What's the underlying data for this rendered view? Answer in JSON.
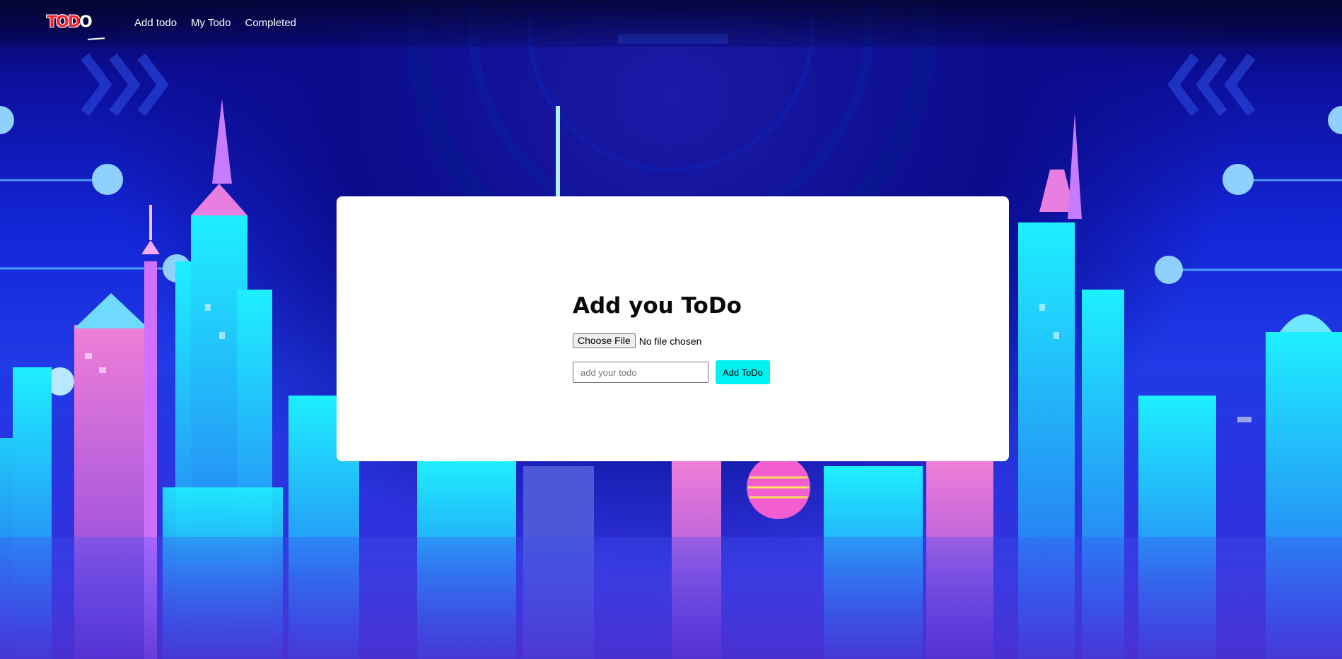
{
  "brand": {
    "logo_text_prefix": "TOD",
    "logo_text_suffix": "O"
  },
  "nav": {
    "items": [
      {
        "label": "Add todo"
      },
      {
        "label": "My Todo"
      },
      {
        "label": "Completed"
      }
    ]
  },
  "form": {
    "title": "Add you ToDo",
    "file_button_label": "Choose File",
    "file_status": "No file chosen",
    "todo_placeholder": "add your todo",
    "todo_value": "",
    "submit_label": "Add ToDo"
  },
  "colors": {
    "accent": "#00f2f2",
    "brand_red": "#ff1e2d",
    "background": "#1426d8",
    "card": "#ffffff"
  }
}
